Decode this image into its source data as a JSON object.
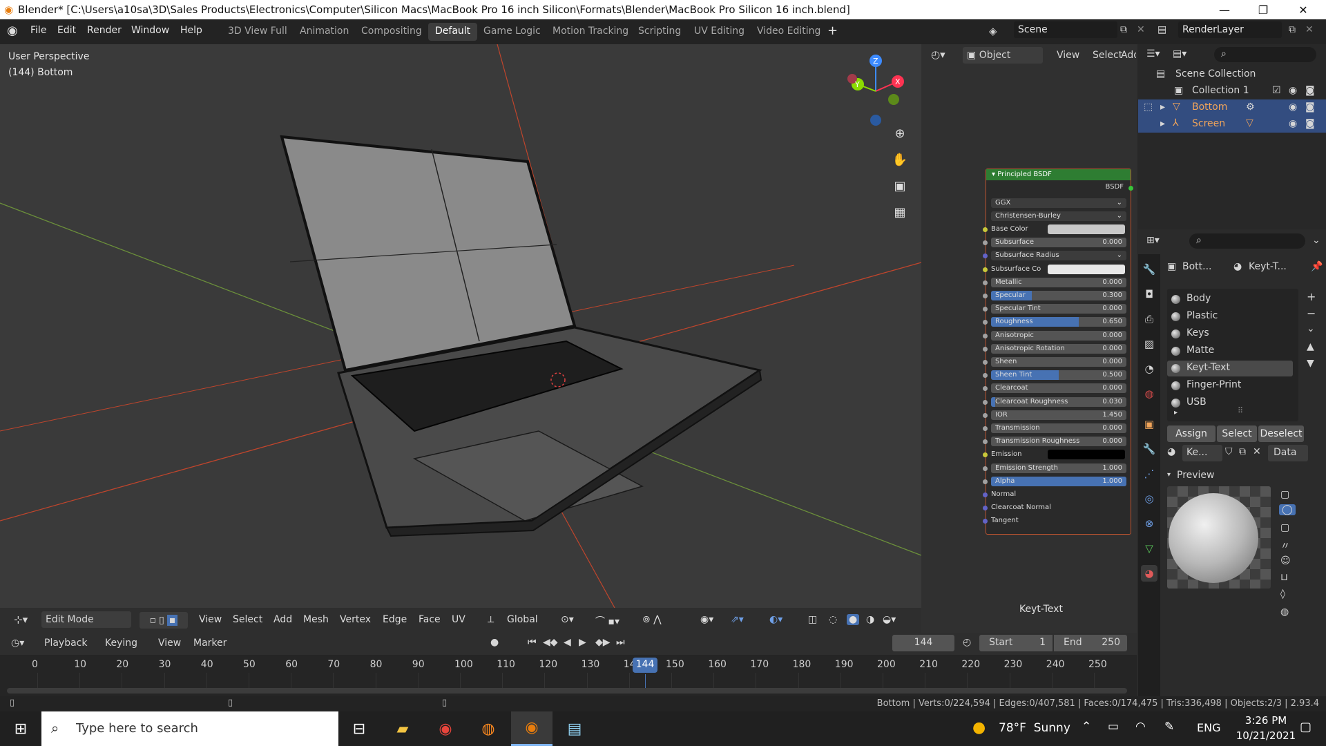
{
  "title_bar": {
    "title": "Blender* [C:\\Users\\a10sa\\3D\\Sales Products\\Electronics\\Computer\\Silicon Macs\\MacBook Pro 16 inch Silicon\\Formats\\Blender\\MacBook Pro Silicon 16 inch.blend]",
    "minimize": "—",
    "maximize": "❐",
    "close": "✕"
  },
  "menus": [
    "File",
    "Edit",
    "Render",
    "Window",
    "Help"
  ],
  "workspaces": [
    "3D View Full",
    "Animation",
    "Compositing",
    "Default",
    "Game Logic",
    "Motion Tracking",
    "Scripting",
    "UV Editing",
    "Video Editing"
  ],
  "active_workspace": "Default",
  "add_workspace": "+",
  "scene": {
    "name": "Scene",
    "render_layer": "RenderLayer"
  },
  "node_editor_header": {
    "mode": "Object",
    "view": "View",
    "select": "Select",
    "add": "Add"
  },
  "viewport": {
    "perspective_label": "User Perspective",
    "object_label": "(144) Bottom",
    "gizmo": {
      "z": "Z",
      "x": "X",
      "y": "Y"
    }
  },
  "viewport_header": {
    "mode": "Edit Mode",
    "menus": [
      "View",
      "Select",
      "Add",
      "Mesh",
      "Vertex",
      "Edge",
      "Face",
      "UV"
    ],
    "transform_orientation": "Global"
  },
  "node": {
    "title": "Principled BSDF",
    "output": "BSDF",
    "distribution": "GGX",
    "subsurface_method": "Christensen-Burley",
    "inputs": [
      {
        "label": "Base Color",
        "kind": "color",
        "color": "#c8c8c8",
        "socket": "yellow"
      },
      {
        "label": "Subsurface",
        "value": "0.000",
        "fill": 0,
        "socket": "grey"
      },
      {
        "label": "Subsurface Radius",
        "kind": "dropdown",
        "socket": "purple"
      },
      {
        "label": "Subsurface Co",
        "kind": "color",
        "color": "#e8e8e8",
        "socket": "yellow"
      },
      {
        "label": "Metallic",
        "value": "0.000",
        "fill": 0,
        "socket": "grey"
      },
      {
        "label": "Specular",
        "value": "0.300",
        "fill": 0.3,
        "socket": "grey"
      },
      {
        "label": "Specular Tint",
        "value": "0.000",
        "fill": 0,
        "socket": "grey"
      },
      {
        "label": "Roughness",
        "value": "0.650",
        "fill": 0.65,
        "socket": "grey"
      },
      {
        "label": "Anisotropic",
        "value": "0.000",
        "fill": 0,
        "socket": "grey"
      },
      {
        "label": "Anisotropic Rotation",
        "value": "0.000",
        "fill": 0,
        "socket": "grey"
      },
      {
        "label": "Sheen",
        "value": "0.000",
        "fill": 0,
        "socket": "grey"
      },
      {
        "label": "Sheen Tint",
        "value": "0.500",
        "fill": 0.5,
        "socket": "grey"
      },
      {
        "label": "Clearcoat",
        "value": "0.000",
        "fill": 0,
        "socket": "grey"
      },
      {
        "label": "Clearcoat Roughness",
        "value": "0.030",
        "fill": 0.03,
        "socket": "grey"
      },
      {
        "label": "IOR",
        "value": "1.450",
        "fill": 0,
        "socket": "grey"
      },
      {
        "label": "Transmission",
        "value": "0.000",
        "fill": 0,
        "socket": "grey"
      },
      {
        "label": "Transmission Roughness",
        "value": "0.000",
        "fill": 0,
        "socket": "grey"
      },
      {
        "label": "Emission",
        "kind": "color",
        "color": "#000000",
        "socket": "yellow"
      },
      {
        "label": "Emission Strength",
        "value": "1.000",
        "fill": 0,
        "socket": "grey"
      },
      {
        "label": "Alpha",
        "value": "1.000",
        "fill": 1,
        "socket": "grey"
      },
      {
        "label": "Normal",
        "kind": "socket",
        "socket": "purple"
      },
      {
        "label": "Clearcoat Normal",
        "kind": "socket",
        "socket": "purple"
      },
      {
        "label": "Tangent",
        "kind": "socket",
        "socket": "purple"
      }
    ]
  },
  "node_area_footer": "Keyt-Text",
  "outliner": {
    "scene_collection": "Scene Collection",
    "items": [
      {
        "label": "Collection 1",
        "selected": false
      },
      {
        "label": "Bottom",
        "selected": true
      },
      {
        "label": "Screen",
        "selected": true
      }
    ]
  },
  "properties": {
    "breadcrumb_object": "Bott...",
    "breadcrumb_material": "Keyt-T...",
    "material_slots": [
      "Body",
      "Plastic",
      "Keys",
      "Matte",
      "Keyt-Text",
      "Finger-Print",
      "USB"
    ],
    "selected_slot": "Keyt-Text",
    "assign": "Assign",
    "select": "Select",
    "deselect": "Deselect",
    "material_name": "Ke...",
    "link": "Data",
    "preview_label": "Preview"
  },
  "timeline": {
    "menus": [
      "Playback",
      "Keying",
      "View",
      "Marker"
    ],
    "current_frame": "144",
    "start_label": "Start",
    "start": "1",
    "end_label": "End",
    "end": "250",
    "ticks": [
      "0",
      "10",
      "20",
      "30",
      "40",
      "50",
      "60",
      "70",
      "80",
      "90",
      "100",
      "110",
      "120",
      "130",
      "140",
      "150",
      "160",
      "170",
      "180",
      "190",
      "200",
      "210",
      "220",
      "230",
      "240",
      "250"
    ],
    "cursor_label": "144"
  },
  "status_bar": "Bottom | Verts:0/224,594 | Edges:0/407,581 | Faces:0/174,475 | Tris:336,498 | Objects:2/3 | 2.93.4",
  "taskbar": {
    "search_placeholder": "Type here to search",
    "weather": "78°F  Sunny",
    "lang": "ENG",
    "time": "3:26 PM",
    "date": "10/21/2021"
  }
}
